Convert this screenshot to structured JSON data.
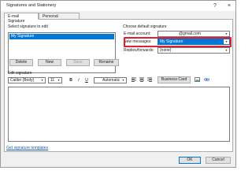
{
  "window": {
    "title": "Signatures and Stationery",
    "help_label": "?",
    "close_label": "×"
  },
  "tabs": [
    {
      "label": "E-mail Signature"
    },
    {
      "label": "Personal Stationery"
    }
  ],
  "left": {
    "select_label": "Select signature to edit",
    "signatures": [
      "My Signature"
    ],
    "buttons": {
      "delete": "Delete",
      "new": "New",
      "save": "Save",
      "rename": "Rename"
    }
  },
  "right": {
    "default_label": "Choose default signature",
    "email_account_label": "E-mail account:",
    "email_account_value": "@gmail.com",
    "new_messages_label": "New messages:",
    "new_messages_value": "My Signature",
    "replies_label": "Replies/forwards:",
    "replies_value": "(none)"
  },
  "editor": {
    "edit_label": "Edit signature",
    "font": "Calibri (Body)",
    "size": "11",
    "bold": "B",
    "italic": "I",
    "underline": "U",
    "color": "Automatic",
    "business_card": "Business Card"
  },
  "footer": {
    "templates_link": "Get signature templates",
    "ok": "OK",
    "cancel": "Cancel"
  },
  "colors": {
    "accent": "#0078d7",
    "highlight": "#e0202a"
  }
}
